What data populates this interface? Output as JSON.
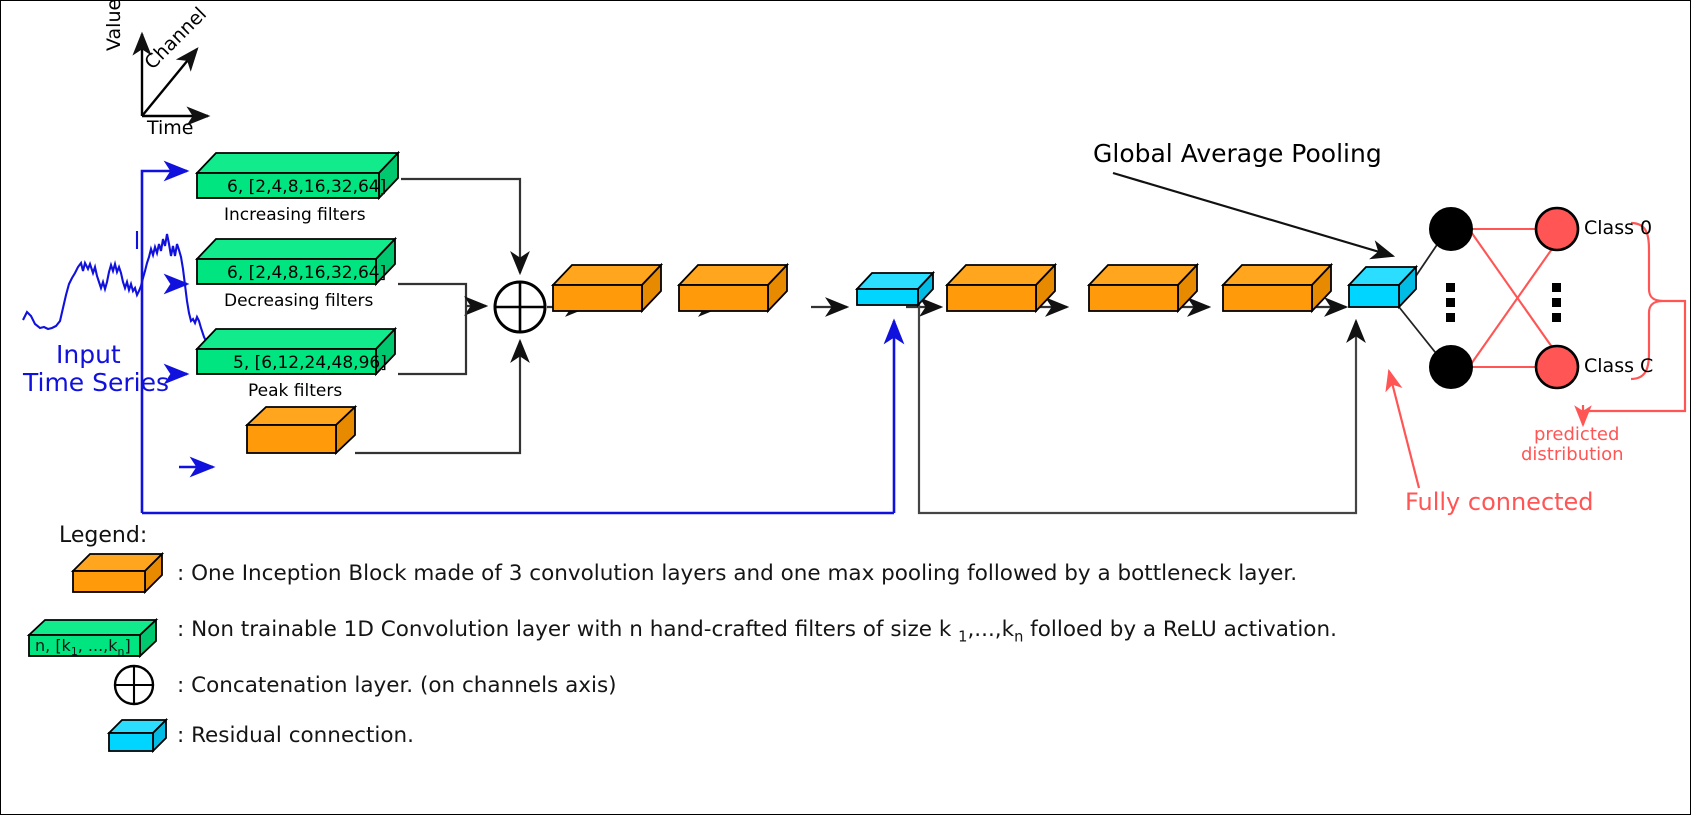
{
  "figure": {
    "title_axes": {
      "value": "Value",
      "time": "Time",
      "channel": "Channel"
    },
    "input": {
      "line1": "Input",
      "line2": "Time Series"
    },
    "handcrafted_blocks": [
      {
        "text": "6, [2,4,8,16,32,64]",
        "caption": "Increasing filters"
      },
      {
        "text": "6, [2,4,8,16,32,64]",
        "caption": "Decreasing filters"
      },
      {
        "text": "5, [6,12,24,48,96]",
        "caption": "Peak filters"
      }
    ],
    "annotations": {
      "global_average_pooling": "Global Average Pooling",
      "fully_connected": "Fully connected",
      "predicted_line1": "predicted",
      "predicted_line2": "distribution"
    },
    "classes": {
      "first": "Class 0",
      "last": "Class C"
    }
  },
  "legend": {
    "title": "Legend:",
    "items": [
      {
        "icon": "orange-cube-icon",
        "text": ": One Inception Block made of 3 convolution layers and one max pooling followed by a bottleneck layer."
      },
      {
        "icon": "green-cube-icon",
        "icon_text_pre": "n, [k",
        "icon_text_sub1": "1",
        "icon_text_mid": ", ...,k",
        "icon_text_sub2": "n",
        "icon_text_post": "]",
        "text_pre": ": Non trainable 1D Convolution layer with n hand-crafted filters of size k ",
        "text_sub1": "1",
        "text_mid": ",...,k",
        "text_sub2": "n",
        "text_post": " folloed by a ReLU activation."
      },
      {
        "icon": "concat-circle-icon",
        "text": ": Concatenation layer. (on channels axis)"
      },
      {
        "icon": "cyan-cube-icon",
        "text": ": Residual connection."
      }
    ]
  },
  "colors": {
    "orange": "#FF9B0A",
    "orange_top": "#FFA51E",
    "orange_side": "#E88A00",
    "green": "#00E57F",
    "green_top": "#12EB8C",
    "green_side": "#00C86E",
    "cyan": "#00D5FF",
    "cyan_top": "#2BDDFF",
    "cyan_side": "#00BCE4",
    "blue": "#1111DD",
    "red": "#FF5555",
    "node_red": "#FF5555",
    "node_black": "#000000",
    "line": "#444444"
  }
}
